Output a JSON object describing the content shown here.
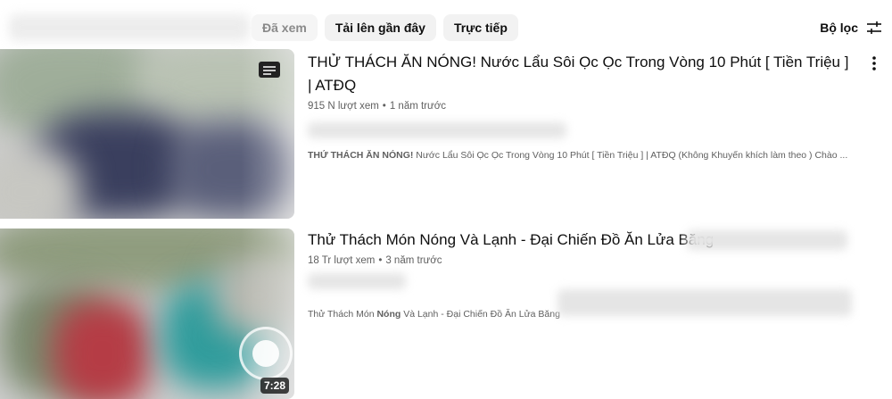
{
  "chips": {
    "items": [
      {
        "label": "Đã xem",
        "faded": true
      },
      {
        "label": "Tải lên gần đây",
        "faded": false
      },
      {
        "label": "Trực tiếp",
        "faded": false
      }
    ],
    "filter_label": "Bộ lọc",
    "filter_icon": "sliders-icon"
  },
  "videos": [
    {
      "title": "THỬ THÁCH ĂN NÓNG! Nước Lẩu Sôi Ọc Ọc Trong Vòng 10 Phút [ Tiền Triệu ] | ATĐQ",
      "views": "915 N lượt xem",
      "age": "1 năm trước",
      "desc_bold": "THỬ THÁCH ĂN NÓNG!",
      "desc_rest": " Nước Lẩu Sôi Ọc Ọc Trong Vòng 10 Phút [ Tiền Triệu ] | ATĐQ (Không Khuyến khích làm theo ) Chào ...",
      "menu_icon": "more-vert-icon",
      "badge_icon": "queue-icon"
    },
    {
      "title": "Thử Thách Món Nóng Và Lạnh - Đại Chiến Đồ Ăn Lửa Băng",
      "views": "18 Tr lượt xem",
      "age": "3 năm trước",
      "desc_pre": "Thử Thách Món ",
      "desc_bold": "Nóng",
      "desc_rest": " Và Lạnh - Đại Chiến Đồ Ăn Lửa Băng",
      "duration": "7:28"
    }
  ],
  "colors": {
    "chip_bg": "#f2f2f2",
    "text_primary": "#0f0f0f",
    "text_secondary": "#606060"
  }
}
